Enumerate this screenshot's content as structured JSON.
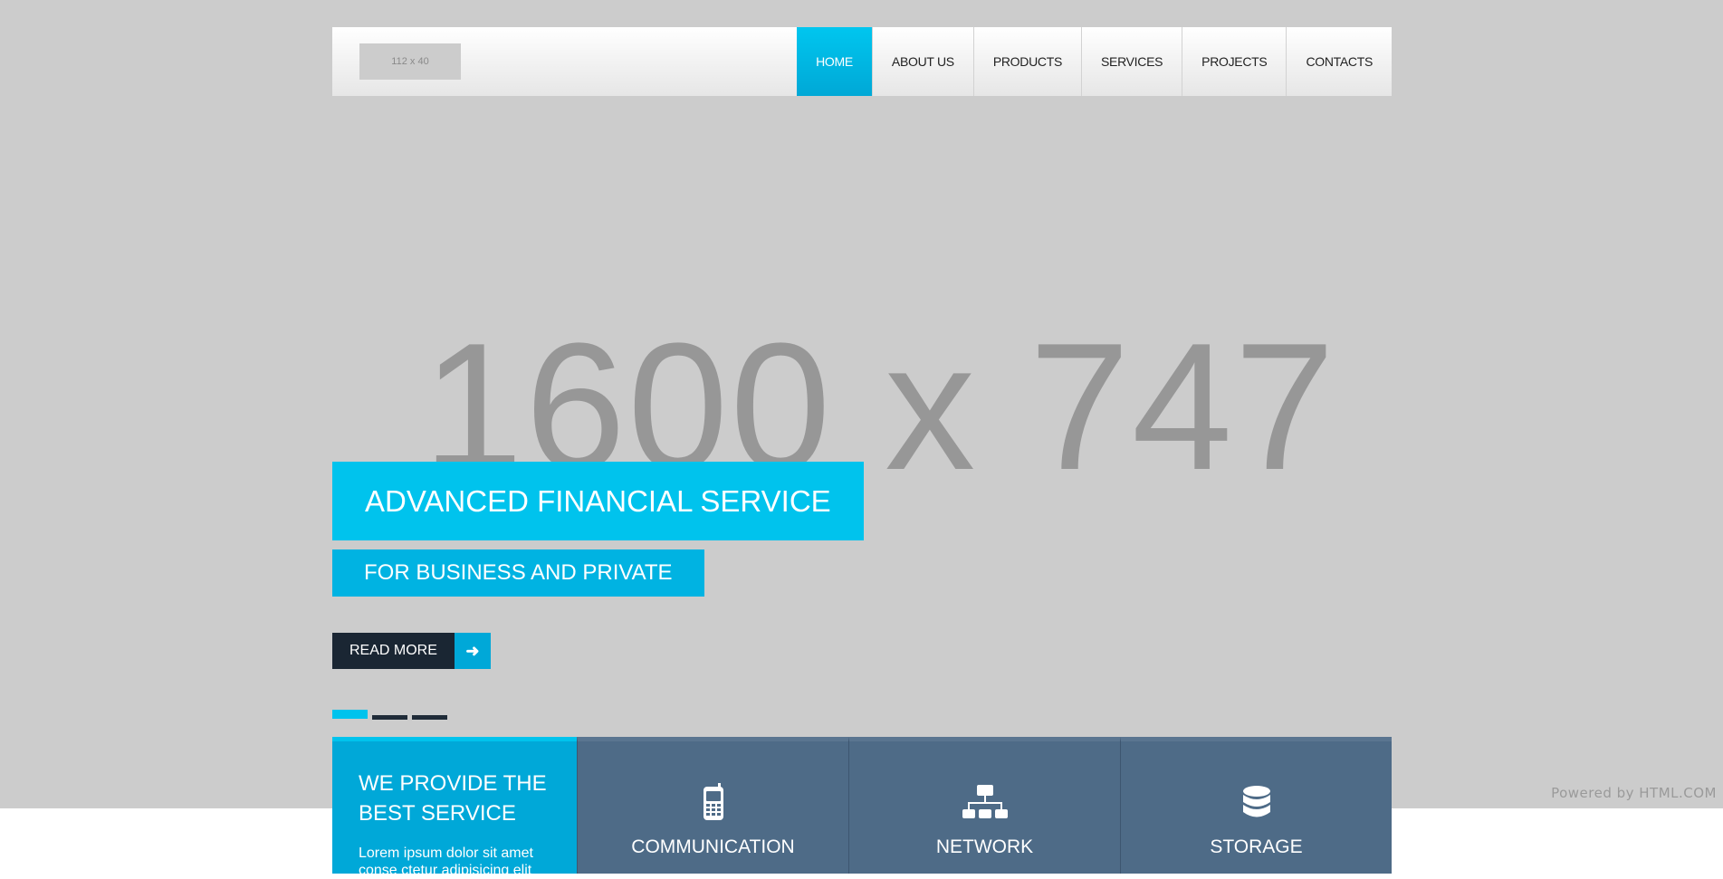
{
  "header": {
    "logo_text": "112 x 40",
    "nav": [
      "HOME",
      "ABOUT US",
      "PRODUCTS",
      "SERVICES",
      "PROJECTS",
      "CONTACTS"
    ]
  },
  "hero": {
    "placeholder": "1600 x 747",
    "caption1": "ADVANCED FINANCIAL SERVICE",
    "caption2": "FOR BUSINESS AND PRIVATE",
    "read_more": "READ MORE"
  },
  "slider": {
    "slides": 3,
    "active": 1
  },
  "intro": {
    "title": "WE PROVIDE THE BEST SERVICE",
    "text": "Lorem ipsum dolor sit amet conse ctetur adipisicing elit"
  },
  "features": [
    {
      "icon": "mobile-phone-icon",
      "title": "COMMUNICATION"
    },
    {
      "icon": "sitemap-icon",
      "title": "NETWORK"
    },
    {
      "icon": "database-icon",
      "title": "STORAGE"
    }
  ],
  "footer": {
    "powered": "Powered by HTML.COM"
  },
  "colors": {
    "accent": "#00c3ed",
    "dark": "#1a2633",
    "slate": "#4e6b87",
    "hero_bg": "#cccccc"
  }
}
